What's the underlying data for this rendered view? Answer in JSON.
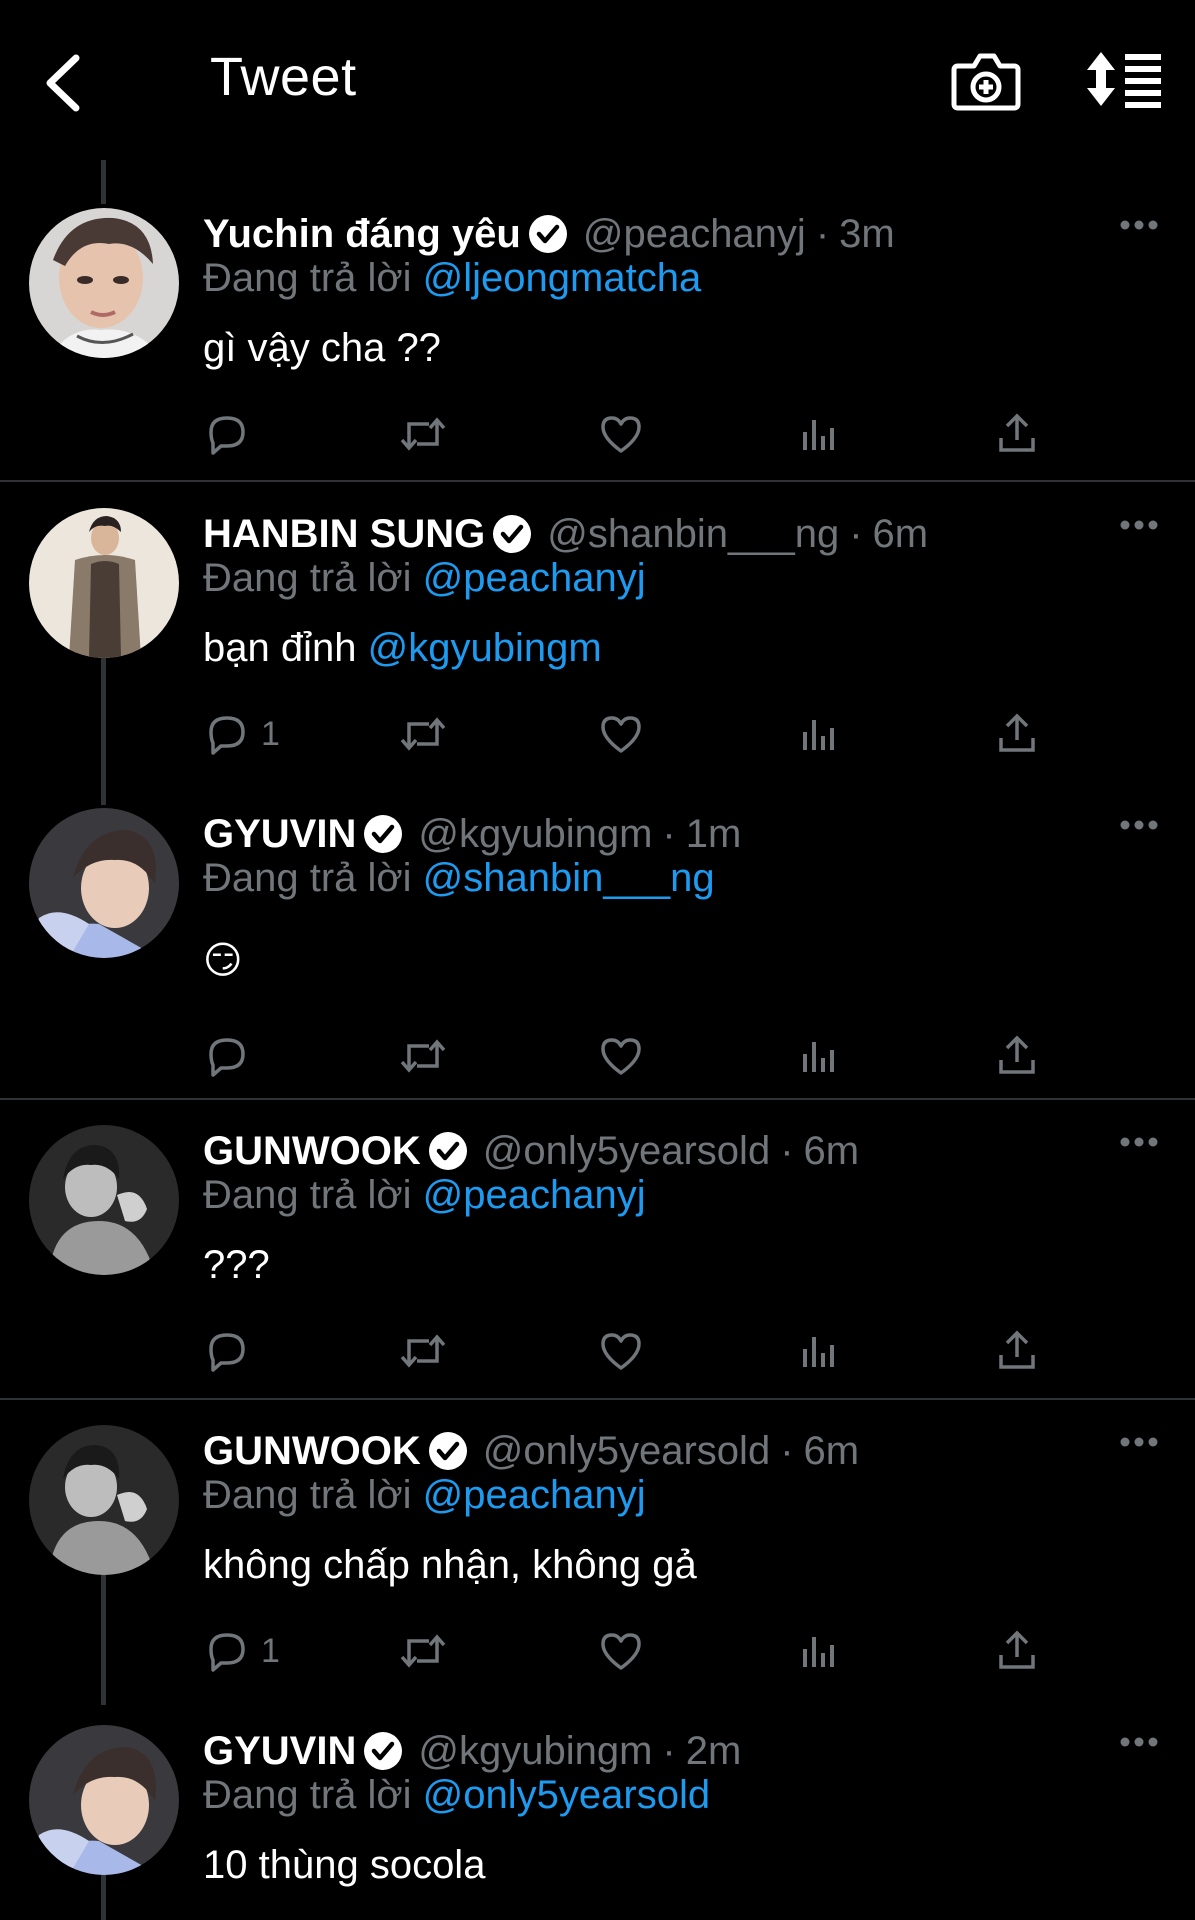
{
  "header": {
    "title": "Tweet"
  },
  "tweets": [
    {
      "name": "Yuchin đáng yêu",
      "handle": "@peachanyj",
      "time": "3m",
      "reply_prefix": "Đang trả lời",
      "reply_to": "@ljeongmatcha",
      "text": "gì vậy cha ??",
      "reply_count": ""
    },
    {
      "name": "HANBIN SUNG",
      "handle": "@shanbin___ng",
      "time": "6m",
      "reply_prefix": "Đang trả lời",
      "reply_to": "@peachanyj",
      "text_plain": "bạn đỉnh ",
      "text_mention": "@kgyubingm",
      "reply_count": "1"
    },
    {
      "name": "GYUVIN",
      "handle": "@kgyubingm",
      "time": "1m",
      "reply_prefix": "Đang trả lời",
      "reply_to": "@shanbin___ng",
      "text": "😏",
      "reply_count": ""
    },
    {
      "name": "GUNWOOK",
      "handle": "@only5yearsold",
      "time": "6m",
      "reply_prefix": "Đang trả lời",
      "reply_to": "@peachanyj",
      "text": "???",
      "reply_count": ""
    },
    {
      "name": "GUNWOOK",
      "handle": "@only5yearsold",
      "time": "6m",
      "reply_prefix": "Đang trả lời",
      "reply_to": "@peachanyj",
      "text": "không chấp nhận, không gả",
      "reply_count": "1"
    },
    {
      "name": "GYUVIN",
      "handle": "@kgyubingm",
      "time": "2m",
      "reply_prefix": "Đang trả lời",
      "reply_to": "@only5yearsold",
      "text": "10 thùng socola",
      "reply_count": ""
    }
  ],
  "dot": "·",
  "icons": {
    "back": "chevron-left-icon",
    "camera": "camera-plus-icon",
    "sort": "sort-icon",
    "verified": "verified-badge-icon",
    "more": "more-horizontal-icon",
    "reply": "reply-icon",
    "retweet": "retweet-icon",
    "like": "heart-icon",
    "views": "views-icon",
    "share": "share-icon"
  },
  "colors": {
    "background": "#000000",
    "text": "#e7e9ea",
    "muted": "#71767b",
    "link": "#1d9bf0",
    "divider": "#2f3336"
  }
}
